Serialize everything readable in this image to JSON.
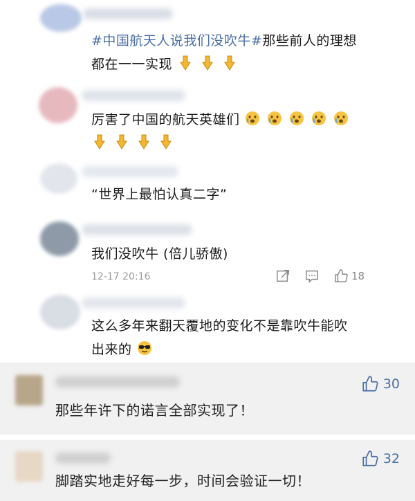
{
  "comments": [
    {
      "hashtag": "#中国航天人说我们没吹牛#",
      "text_line1": "那些前人的理想",
      "text_line2": "都在一一实现",
      "emoji_line2": [
        "point-down",
        "point-down",
        "point-down"
      ]
    },
    {
      "text_line1": "厉害了中国的航天英雄们",
      "emoji_line1": [
        "crying-face",
        "crying-face",
        "crying-face",
        "crying-face",
        "crying-face"
      ],
      "emoji_line2": [
        "point-down",
        "point-down",
        "point-down",
        "point-down"
      ]
    },
    {
      "text_line1": "“世界上最怕认真二字”"
    },
    {
      "text_line1": "我们没吹牛 (倍儿骄傲)",
      "time": "12-17 20:16",
      "like_count": "18"
    },
    {
      "text_line1": "这么多年来翻天覆地的变化不是靠吹牛能吹",
      "text_line2": "出来的",
      "emoji_line2": [
        "sunglasses-face"
      ]
    }
  ],
  "cards": [
    {
      "text": "那些年许下的诺言全部实现了！",
      "like_count": "30"
    },
    {
      "text": "脚踏实地走好每一步，时间会验证一切！",
      "like_count": "32"
    }
  ],
  "colors": {
    "accent": "#4a6fa5",
    "gray_card_bg": "#f1f1f1",
    "meta_text": "#9a9a9a"
  }
}
